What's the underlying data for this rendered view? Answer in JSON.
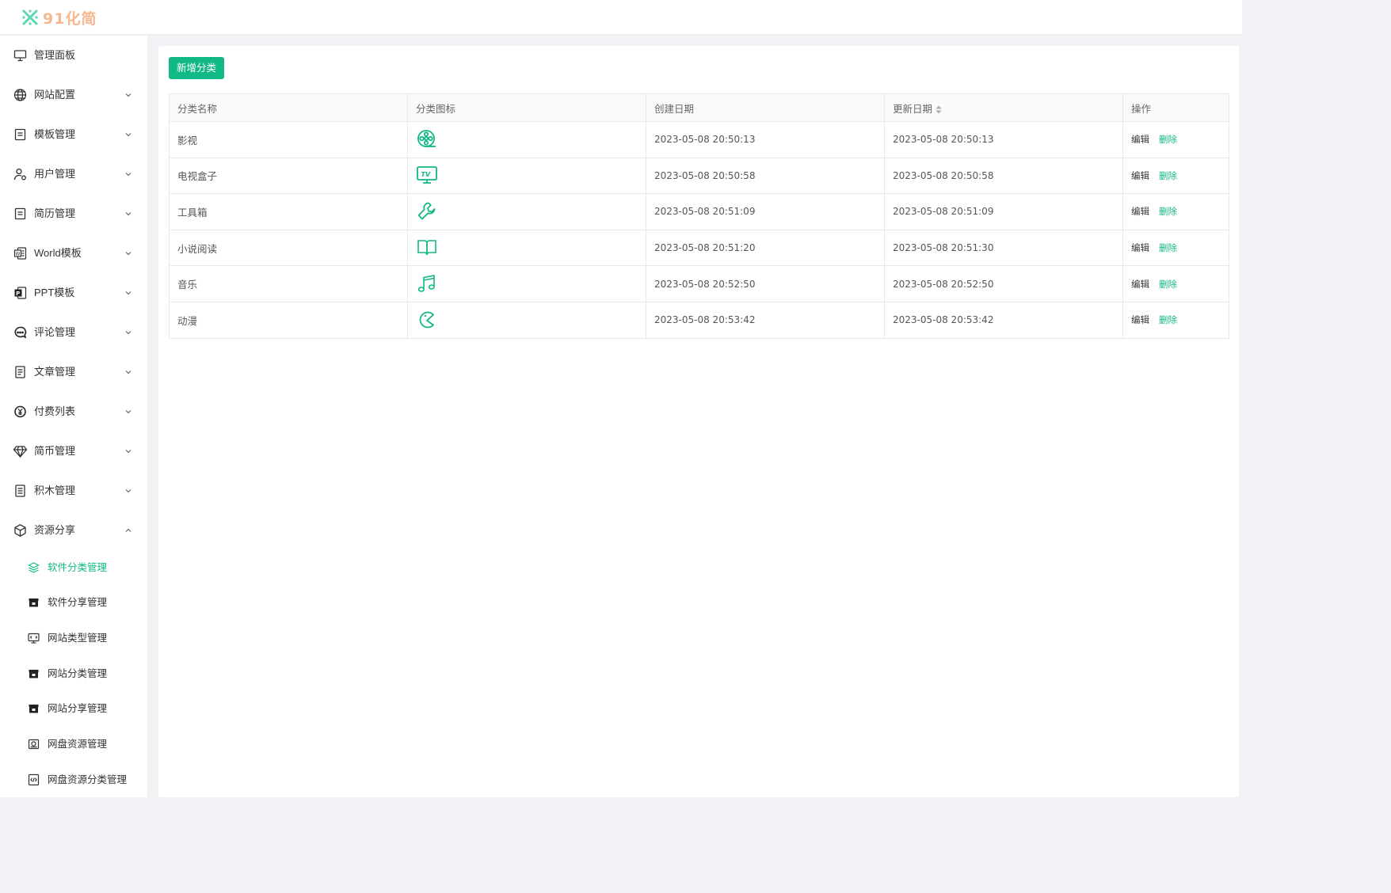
{
  "app": {
    "logo_text": "91化简",
    "brand_color": "#12b886",
    "logo_color": "#f5b88f"
  },
  "sidebar": {
    "items": [
      {
        "label": "管理面板",
        "icon": "monitor-icon",
        "has_arrow": false
      },
      {
        "label": "网站配置",
        "icon": "globe-icon",
        "has_arrow": true
      },
      {
        "label": "模板管理",
        "icon": "template-icon",
        "has_arrow": true
      },
      {
        "label": "用户管理",
        "icon": "user-gear-icon",
        "has_arrow": true
      },
      {
        "label": "简历管理",
        "icon": "resume-icon",
        "has_arrow": true
      },
      {
        "label": "World模板",
        "icon": "word-doc-icon",
        "has_arrow": true
      },
      {
        "label": "PPT模板",
        "icon": "ppt-icon",
        "has_arrow": true
      },
      {
        "label": "评论管理",
        "icon": "comment-icon",
        "has_arrow": true
      },
      {
        "label": "文章管理",
        "icon": "article-icon",
        "has_arrow": true
      },
      {
        "label": "付费列表",
        "icon": "yen-coin-icon",
        "has_arrow": true
      },
      {
        "label": "简币管理",
        "icon": "diamond-icon",
        "has_arrow": true
      },
      {
        "label": "积木管理",
        "icon": "blocks-doc-icon",
        "has_arrow": true
      },
      {
        "label": "资源分享",
        "icon": "cube-icon",
        "has_arrow": true,
        "expanded": true
      }
    ],
    "sub_items": [
      {
        "label": "软件分类管理",
        "icon": "layers-icon",
        "active": true
      },
      {
        "label": "软件分享管理",
        "icon": "archive-box-icon",
        "active": false
      },
      {
        "label": "网站类型管理",
        "icon": "web-code-icon",
        "active": false
      },
      {
        "label": "网站分类管理",
        "icon": "archive-box-icon",
        "active": false
      },
      {
        "label": "网站分享管理",
        "icon": "archive-box-icon",
        "active": false
      },
      {
        "label": "网盘资源管理",
        "icon": "disk-icon",
        "active": false
      },
      {
        "label": "网盘资源分类管理",
        "icon": "code-doc-icon",
        "active": false
      }
    ]
  },
  "toolbar": {
    "add_label": "新增分类"
  },
  "table": {
    "columns": [
      "分类名称",
      "分类图标",
      "创建日期",
      "更新日期",
      "操作"
    ],
    "sortable_column": "更新日期",
    "edit_label": "编辑",
    "delete_label": "删除",
    "rows": [
      {
        "name": "影视",
        "icon": "film-reel-icon",
        "created": "2023-05-08 20:50:13",
        "updated": "2023-05-08 20:50:13"
      },
      {
        "name": "电视盒子",
        "icon": "tv-icon",
        "created": "2023-05-08 20:50:58",
        "updated": "2023-05-08 20:50:58"
      },
      {
        "name": "工具箱",
        "icon": "wrench-icon",
        "created": "2023-05-08 20:51:09",
        "updated": "2023-05-08 20:51:09"
      },
      {
        "name": "小说阅读",
        "icon": "open-book-icon",
        "created": "2023-05-08 20:51:20",
        "updated": "2023-05-08 20:51:30"
      },
      {
        "name": "音乐",
        "icon": "music-note-icon",
        "created": "2023-05-08 20:52:50",
        "updated": "2023-05-08 20:52:50"
      },
      {
        "name": "动漫",
        "icon": "pacman-icon",
        "created": "2023-05-08 20:53:42",
        "updated": "2023-05-08 20:53:42"
      }
    ]
  }
}
